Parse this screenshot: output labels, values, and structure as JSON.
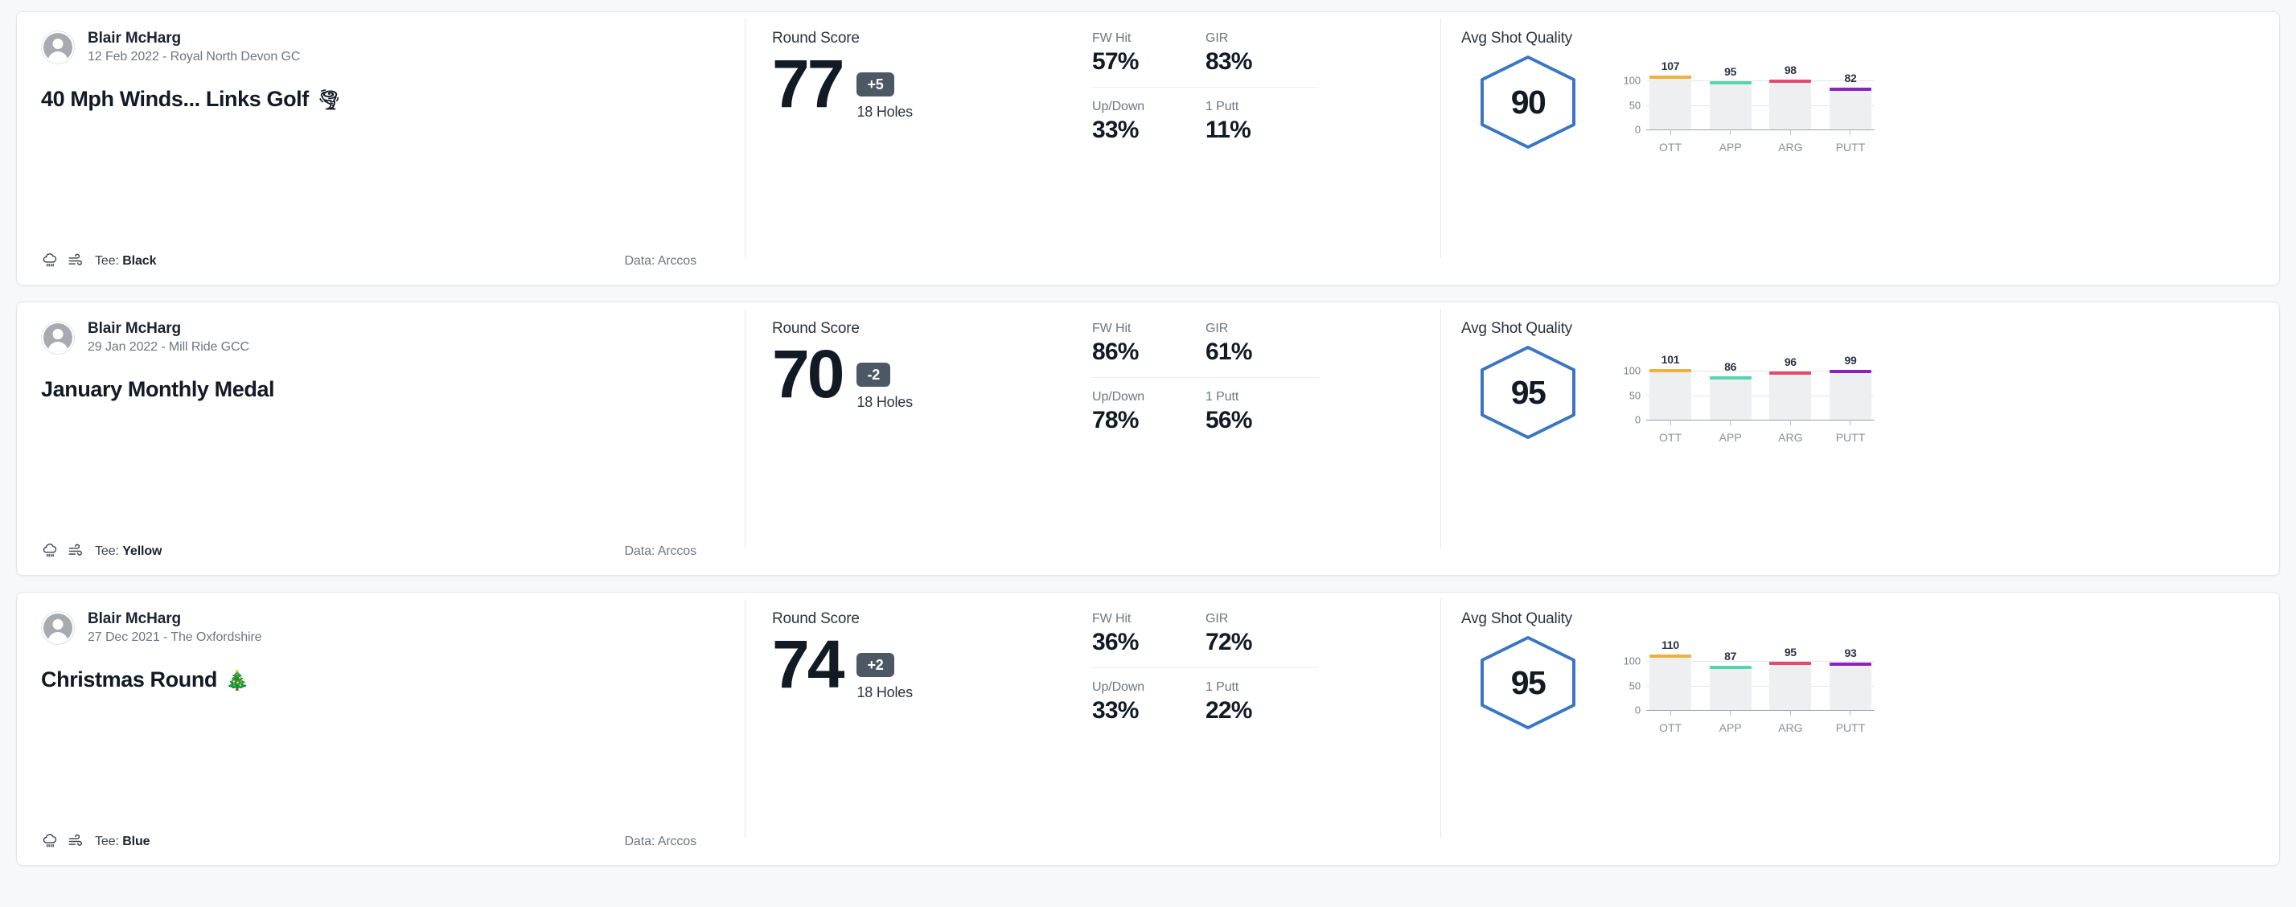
{
  "labels": {
    "round_score": "Round Score",
    "holes": "18 Holes",
    "avg_shot_quality": "Avg Shot Quality",
    "tee_prefix": "Tee:",
    "data_prefix": "Data:",
    "fw_hit": "FW Hit",
    "gir": "GIR",
    "up_down": "Up/Down",
    "one_putt": "1 Putt"
  },
  "chart_axis": {
    "y_ticks": [
      "100",
      "50",
      "0"
    ],
    "categories": [
      "OTT",
      "APP",
      "ARG",
      "PUTT"
    ]
  },
  "colors": {
    "ott": "#eeb23c",
    "app": "#54d4b4",
    "arg": "#e44a6c",
    "putt": "#8c23bd",
    "hexagon_stroke": "#3b76c4",
    "badge_bg": "#4d5865",
    "bar_track": "#eeeff0"
  },
  "rounds": [
    {
      "user": "Blair McHarg",
      "date_course": "12 Feb 2022 - Royal North Devon GC",
      "title": "40 Mph Winds... Links Golf",
      "title_emoji": "🌪",
      "weather_icons": [
        "rain-cloud-icon",
        "wind-icon"
      ],
      "tee": "Black",
      "data_source": "Arccos",
      "score": "77",
      "diff": "+5",
      "holes": "18 Holes",
      "fw_hit": "57%",
      "gir": "83%",
      "up_down": "33%",
      "one_putt": "11%",
      "avg_quality": "90",
      "chart_data": {
        "type": "bar",
        "title": "Avg Shot Quality",
        "categories": [
          "OTT",
          "APP",
          "ARG",
          "PUTT"
        ],
        "values": [
          107,
          95,
          98,
          82
        ],
        "ylim": [
          0,
          125
        ],
        "yticks": [
          0,
          50,
          100
        ],
        "ylabel": "",
        "xlabel": "",
        "grid": true,
        "legend": "none"
      }
    },
    {
      "user": "Blair McHarg",
      "date_course": "29 Jan 2022 - Mill Ride GCC",
      "title": "January Monthly Medal",
      "title_emoji": "",
      "weather_icons": [
        "rain-cloud-icon",
        "wind-icon"
      ],
      "tee": "Yellow",
      "data_source": "Arccos",
      "score": "70",
      "diff": "-2",
      "holes": "18 Holes",
      "fw_hit": "86%",
      "gir": "61%",
      "up_down": "78%",
      "one_putt": "56%",
      "avg_quality": "95",
      "chart_data": {
        "type": "bar",
        "title": "Avg Shot Quality",
        "categories": [
          "OTT",
          "APP",
          "ARG",
          "PUTT"
        ],
        "values": [
          101,
          86,
          96,
          99
        ],
        "ylim": [
          0,
          125
        ],
        "yticks": [
          0,
          50,
          100
        ],
        "ylabel": "",
        "xlabel": "",
        "grid": true,
        "legend": "none"
      }
    },
    {
      "user": "Blair McHarg",
      "date_course": "27 Dec 2021 - The Oxfordshire",
      "title": "Christmas Round",
      "title_emoji": "🎄",
      "weather_icons": [
        "rain-cloud-icon",
        "wind-icon"
      ],
      "tee": "Blue",
      "data_source": "Arccos",
      "score": "74",
      "diff": "+2",
      "holes": "18 Holes",
      "fw_hit": "36%",
      "gir": "72%",
      "up_down": "33%",
      "one_putt": "22%",
      "avg_quality": "95",
      "chart_data": {
        "type": "bar",
        "title": "Avg Shot Quality",
        "categories": [
          "OTT",
          "APP",
          "ARG",
          "PUTT"
        ],
        "values": [
          110,
          87,
          95,
          93
        ],
        "ylim": [
          0,
          125
        ],
        "yticks": [
          0,
          50,
          100
        ],
        "ylabel": "",
        "xlabel": "",
        "grid": true,
        "legend": "none"
      }
    }
  ]
}
